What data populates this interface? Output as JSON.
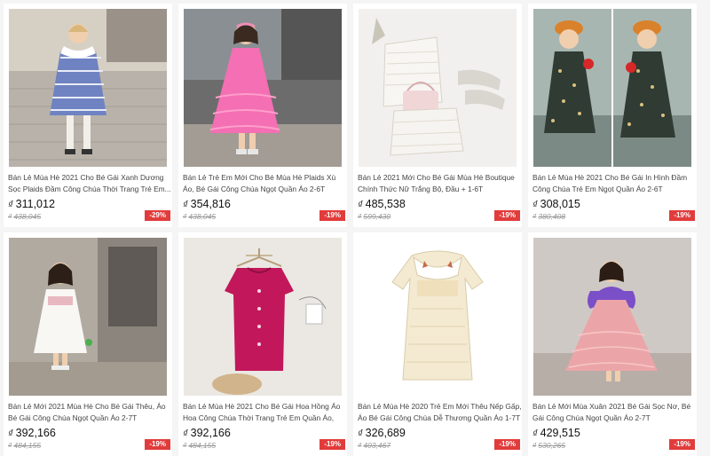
{
  "currency_symbol": "₫",
  "products": [
    {
      "title": "Bán Lẻ Mùa Hè 2021 Cho Bé Gái Xanh Dương Sọc Plaids Đầm Công Chúa Thời Trang Trẻ Em...",
      "price": "311,012",
      "original_price": "438,045",
      "discount": "-29%",
      "image": "girl-blue-striped-dress-photo"
    },
    {
      "title": "Bán Lẻ Trẻ Em Mới Cho Bé Mùa Hè Plaids Xù Áo, Bé Gái Công Chúa Ngọt Quần Áo 2-6T",
      "price": "354,816",
      "original_price": "438,045",
      "discount": "-19%",
      "image": "girl-pink-ruffle-dress-photo"
    },
    {
      "title": "Bán Lẻ 2021 Mới Cho Bé Gái Mùa Hè Boutique Chính Thức Nữ Trắng Bộ, Đầu + 1-6T",
      "price": "485,538",
      "original_price": "599,430",
      "discount": "-19%",
      "image": "white-tweed-outfit-flatlay-photo"
    },
    {
      "title": "Bán Lẻ Mùa Hè 2021 Cho Bé Gái In Hình Đầm Công Chúa Trẻ Em Ngọt Quần Áo 2-6T",
      "price": "308,015",
      "original_price": "380,408",
      "discount": "-19%",
      "image": "girl-floral-dress-beret-photo"
    },
    {
      "title": "Bán Lẻ Mới 2021 Mùa Hè Cho Bé Gái Thêu, Áo Bé Gái Công Chúa Ngọt Quần Áo 2-7T",
      "price": "392,166",
      "original_price": "484,155",
      "discount": "-19%",
      "image": "girl-white-embroidered-dress-photo"
    },
    {
      "title": "Bán Lẻ Mùa Hè 2021 Cho Bé Gái Hoa Hồng Áo Hoa Công Chúa Thời Trang Trẻ Em Quần Áo, 1-...",
      "price": "392,166",
      "original_price": "484,155",
      "discount": "-19%",
      "image": "magenta-dress-on-hanger-photo"
    },
    {
      "title": "Bán Lẻ Mùa Hè 2020 Trẻ Em Mới Thêu Nếp Gấp, Áo Bé Gái Công Chúa Dễ Thương Quần Áo 1-7T",
      "price": "326,689",
      "original_price": "403,467",
      "discount": "-19%",
      "image": "cream-collar-dress-photo"
    },
    {
      "title": "Bán Lẻ Mới Mùa Xuân 2021 Bé Gái Sọc Nơ, Bé Gái Công Chúa Ngọt Quần Áo 2-7T",
      "price": "429,515",
      "original_price": "530,265",
      "discount": "-19%",
      "image": "girl-pink-bow-tulle-dress-photo"
    }
  ]
}
